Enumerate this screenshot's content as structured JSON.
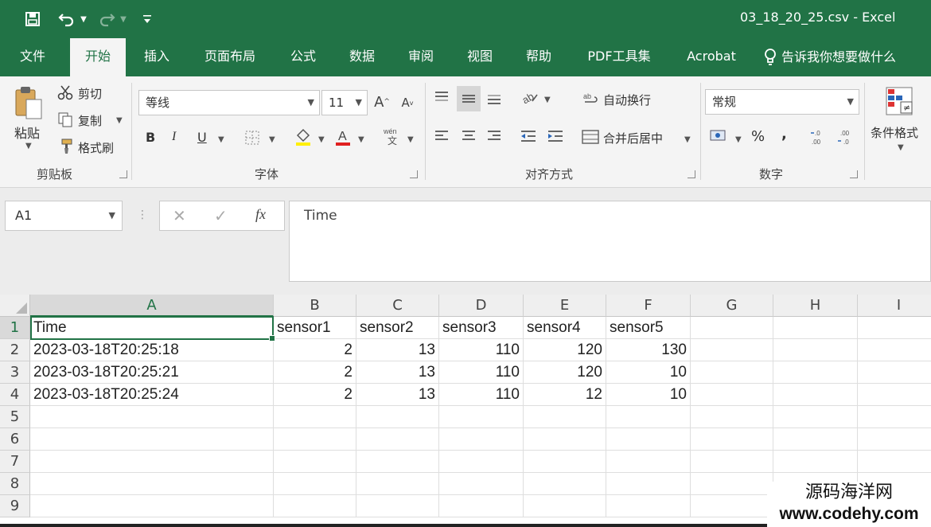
{
  "title_bar": {
    "file_title": "03_18_20_25.csv  -  Excel",
    "icons": [
      "save-icon",
      "undo-icon",
      "redo-icon",
      "customize-quick-access-icon"
    ]
  },
  "colors": {
    "excel_green": "#217346",
    "ribbon_bg": "#f4f4f4"
  },
  "tabs": [
    {
      "label": "文件"
    },
    {
      "label": "开始"
    },
    {
      "label": "插入"
    },
    {
      "label": "页面布局"
    },
    {
      "label": "公式"
    },
    {
      "label": "数据"
    },
    {
      "label": "审阅"
    },
    {
      "label": "视图"
    },
    {
      "label": "帮助"
    },
    {
      "label": "PDF工具集"
    },
    {
      "label": "Acrobat"
    },
    {
      "label": "告诉我你想要做什么"
    }
  ],
  "ribbon": {
    "clipboard": {
      "paste_label": "粘贴",
      "cut_label": "剪切",
      "copy_label": "复制",
      "format_painter_label": "格式刷",
      "group_label": "剪贴板"
    },
    "font": {
      "font_name": "等线",
      "font_size": "11",
      "bold": "B",
      "italic": "I",
      "underline": "U",
      "group_label": "字体"
    },
    "alignment": {
      "wrap_text_label": "自动换行",
      "merge_center_label": "合并后居中",
      "group_label": "对齐方式"
    },
    "number": {
      "format": "常规",
      "percent": "%",
      "comma": ",",
      "group_label": "数字"
    },
    "styles": {
      "conditional_format_label": "条件格式"
    }
  },
  "formula_bar": {
    "name_box": "A1",
    "fx_label": "fx",
    "content": "Time"
  },
  "sheet": {
    "columns": [
      "A",
      "B",
      "C",
      "D",
      "E",
      "F",
      "G",
      "H",
      "I"
    ],
    "row_numbers": [
      "1",
      "2",
      "3",
      "4",
      "5",
      "6",
      "7",
      "8",
      "9"
    ],
    "rows": [
      [
        "Time",
        "sensor1",
        "sensor2",
        "sensor3",
        "sensor4",
        "sensor5"
      ],
      [
        "2023-03-18T20:25:18",
        "2",
        "13",
        "110",
        "120",
        "130"
      ],
      [
        "2023-03-18T20:25:21",
        "2",
        "13",
        "110",
        "120",
        "10"
      ],
      [
        "2023-03-18T20:25:24",
        "2",
        "13",
        "110",
        "12",
        "10"
      ]
    ]
  },
  "watermark": {
    "line1": "源码海洋网",
    "line2": "www.codehy.com"
  }
}
